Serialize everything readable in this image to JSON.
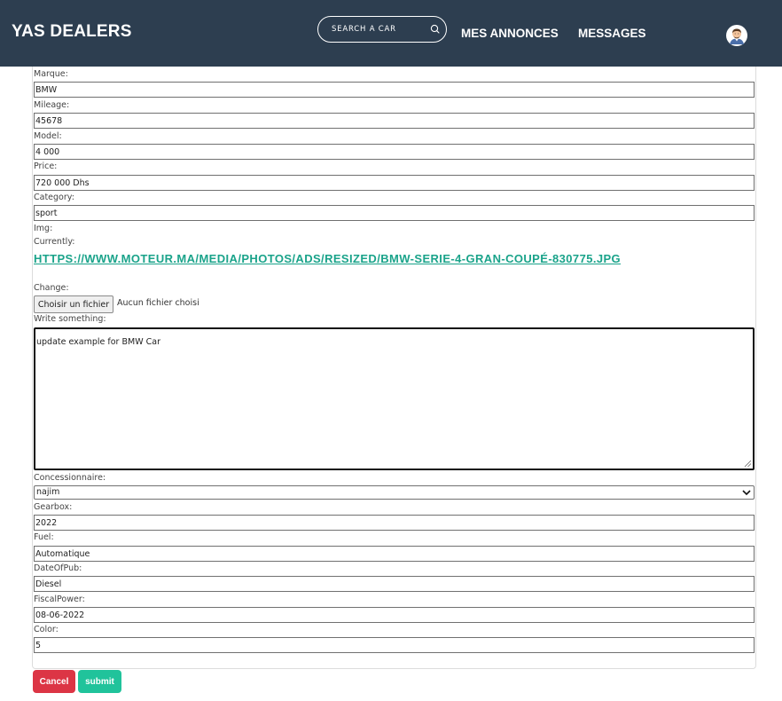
{
  "navbar": {
    "brand": "YAS DEALERS",
    "search_placeholder": "SEARCH A CAR",
    "links": [
      "MES ANNONCES",
      "MESSAGES"
    ]
  },
  "form": {
    "marque": {
      "label": "Marque:",
      "value": "BMW"
    },
    "mileage": {
      "label": "Mileage:",
      "value": "45678"
    },
    "model": {
      "label": "Model:",
      "value": "4 000"
    },
    "price": {
      "label": "Price:",
      "value": "720 000 Dhs"
    },
    "category": {
      "label": "Category:",
      "value": "sport"
    },
    "img": {
      "label": "Img:",
      "currently_label": "Currently:",
      "current_url": "HTTPS://WWW.MOTEUR.MA/MEDIA/PHOTOS/ADS/RESIZED/BMW-SERIE-4-GRAN-COUPÉ-830775.JPG",
      "change_label": "Change:",
      "file_button": "Choisir un fichier",
      "file_status": "Aucun fichier choisi"
    },
    "description": {
      "label": "Write something:",
      "value": "update example for BMW Car"
    },
    "concessionnaire": {
      "label": "Concessionnaire:",
      "value": "najim"
    },
    "gearbox": {
      "label": "Gearbox:",
      "value": "2022"
    },
    "fuel": {
      "label": "Fuel:",
      "value": "Automatique"
    },
    "dateofpub": {
      "label": "DateOfPub:",
      "value": "Diesel"
    },
    "fiscalpower": {
      "label": "FiscalPower:",
      "value": "08-06-2022"
    },
    "color": {
      "label": "Color:",
      "value": "5"
    },
    "buttons": {
      "cancel": "Cancel",
      "submit": "submit"
    }
  },
  "colors": {
    "navbar_bg": "#2d3e50",
    "link_accent": "#1aa38a",
    "cancel_bg": "#dc3545",
    "submit_bg": "#20c39b"
  },
  "icons": [
    "search-icon",
    "avatar",
    "chevron-down-icon",
    "resize-grip-icon"
  ]
}
